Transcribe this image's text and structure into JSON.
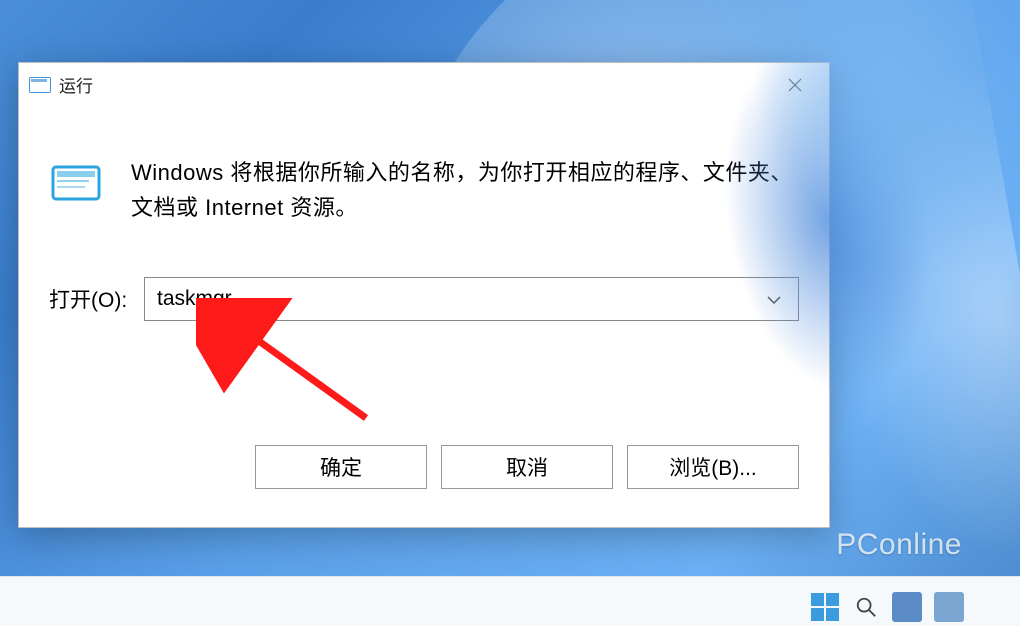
{
  "dialog": {
    "title": "运行",
    "description": "Windows 将根据你所输入的名称，为你打开相应的程序、文件夹、文档或 Internet 资源。",
    "open_label": "打开(O):",
    "input_value": "taskmgr",
    "buttons": {
      "ok": "确定",
      "cancel": "取消",
      "browse": "浏览(B)..."
    }
  },
  "watermark": "PConline"
}
